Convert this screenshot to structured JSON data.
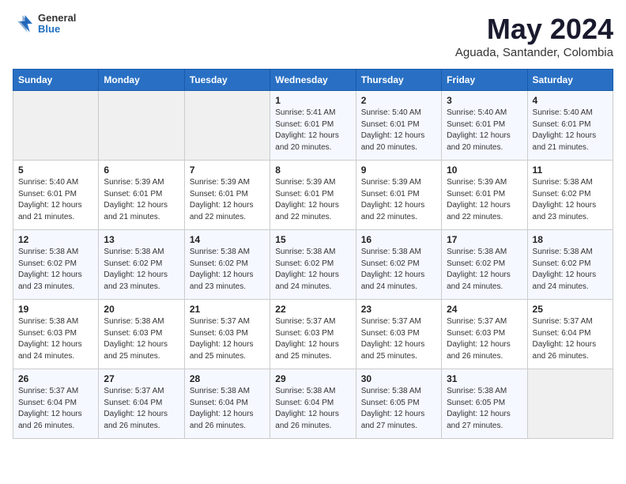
{
  "header": {
    "logo_line1": "General",
    "logo_line2": "Blue",
    "month": "May 2024",
    "location": "Aguada, Santander, Colombia"
  },
  "weekdays": [
    "Sunday",
    "Monday",
    "Tuesday",
    "Wednesday",
    "Thursday",
    "Friday",
    "Saturday"
  ],
  "weeks": [
    [
      {
        "day": "",
        "info": ""
      },
      {
        "day": "",
        "info": ""
      },
      {
        "day": "",
        "info": ""
      },
      {
        "day": "1",
        "info": "Sunrise: 5:41 AM\nSunset: 6:01 PM\nDaylight: 12 hours\nand 20 minutes."
      },
      {
        "day": "2",
        "info": "Sunrise: 5:40 AM\nSunset: 6:01 PM\nDaylight: 12 hours\nand 20 minutes."
      },
      {
        "day": "3",
        "info": "Sunrise: 5:40 AM\nSunset: 6:01 PM\nDaylight: 12 hours\nand 20 minutes."
      },
      {
        "day": "4",
        "info": "Sunrise: 5:40 AM\nSunset: 6:01 PM\nDaylight: 12 hours\nand 21 minutes."
      }
    ],
    [
      {
        "day": "5",
        "info": "Sunrise: 5:40 AM\nSunset: 6:01 PM\nDaylight: 12 hours\nand 21 minutes."
      },
      {
        "day": "6",
        "info": "Sunrise: 5:39 AM\nSunset: 6:01 PM\nDaylight: 12 hours\nand 21 minutes."
      },
      {
        "day": "7",
        "info": "Sunrise: 5:39 AM\nSunset: 6:01 PM\nDaylight: 12 hours\nand 22 minutes."
      },
      {
        "day": "8",
        "info": "Sunrise: 5:39 AM\nSunset: 6:01 PM\nDaylight: 12 hours\nand 22 minutes."
      },
      {
        "day": "9",
        "info": "Sunrise: 5:39 AM\nSunset: 6:01 PM\nDaylight: 12 hours\nand 22 minutes."
      },
      {
        "day": "10",
        "info": "Sunrise: 5:39 AM\nSunset: 6:01 PM\nDaylight: 12 hours\nand 22 minutes."
      },
      {
        "day": "11",
        "info": "Sunrise: 5:38 AM\nSunset: 6:02 PM\nDaylight: 12 hours\nand 23 minutes."
      }
    ],
    [
      {
        "day": "12",
        "info": "Sunrise: 5:38 AM\nSunset: 6:02 PM\nDaylight: 12 hours\nand 23 minutes."
      },
      {
        "day": "13",
        "info": "Sunrise: 5:38 AM\nSunset: 6:02 PM\nDaylight: 12 hours\nand 23 minutes."
      },
      {
        "day": "14",
        "info": "Sunrise: 5:38 AM\nSunset: 6:02 PM\nDaylight: 12 hours\nand 23 minutes."
      },
      {
        "day": "15",
        "info": "Sunrise: 5:38 AM\nSunset: 6:02 PM\nDaylight: 12 hours\nand 24 minutes."
      },
      {
        "day": "16",
        "info": "Sunrise: 5:38 AM\nSunset: 6:02 PM\nDaylight: 12 hours\nand 24 minutes."
      },
      {
        "day": "17",
        "info": "Sunrise: 5:38 AM\nSunset: 6:02 PM\nDaylight: 12 hours\nand 24 minutes."
      },
      {
        "day": "18",
        "info": "Sunrise: 5:38 AM\nSunset: 6:02 PM\nDaylight: 12 hours\nand 24 minutes."
      }
    ],
    [
      {
        "day": "19",
        "info": "Sunrise: 5:38 AM\nSunset: 6:03 PM\nDaylight: 12 hours\nand 24 minutes."
      },
      {
        "day": "20",
        "info": "Sunrise: 5:38 AM\nSunset: 6:03 PM\nDaylight: 12 hours\nand 25 minutes."
      },
      {
        "day": "21",
        "info": "Sunrise: 5:37 AM\nSunset: 6:03 PM\nDaylight: 12 hours\nand 25 minutes."
      },
      {
        "day": "22",
        "info": "Sunrise: 5:37 AM\nSunset: 6:03 PM\nDaylight: 12 hours\nand 25 minutes."
      },
      {
        "day": "23",
        "info": "Sunrise: 5:37 AM\nSunset: 6:03 PM\nDaylight: 12 hours\nand 25 minutes."
      },
      {
        "day": "24",
        "info": "Sunrise: 5:37 AM\nSunset: 6:03 PM\nDaylight: 12 hours\nand 26 minutes."
      },
      {
        "day": "25",
        "info": "Sunrise: 5:37 AM\nSunset: 6:04 PM\nDaylight: 12 hours\nand 26 minutes."
      }
    ],
    [
      {
        "day": "26",
        "info": "Sunrise: 5:37 AM\nSunset: 6:04 PM\nDaylight: 12 hours\nand 26 minutes."
      },
      {
        "day": "27",
        "info": "Sunrise: 5:37 AM\nSunset: 6:04 PM\nDaylight: 12 hours\nand 26 minutes."
      },
      {
        "day": "28",
        "info": "Sunrise: 5:38 AM\nSunset: 6:04 PM\nDaylight: 12 hours\nand 26 minutes."
      },
      {
        "day": "29",
        "info": "Sunrise: 5:38 AM\nSunset: 6:04 PM\nDaylight: 12 hours\nand 26 minutes."
      },
      {
        "day": "30",
        "info": "Sunrise: 5:38 AM\nSunset: 6:05 PM\nDaylight: 12 hours\nand 27 minutes."
      },
      {
        "day": "31",
        "info": "Sunrise: 5:38 AM\nSunset: 6:05 PM\nDaylight: 12 hours\nand 27 minutes."
      },
      {
        "day": "",
        "info": ""
      }
    ]
  ]
}
